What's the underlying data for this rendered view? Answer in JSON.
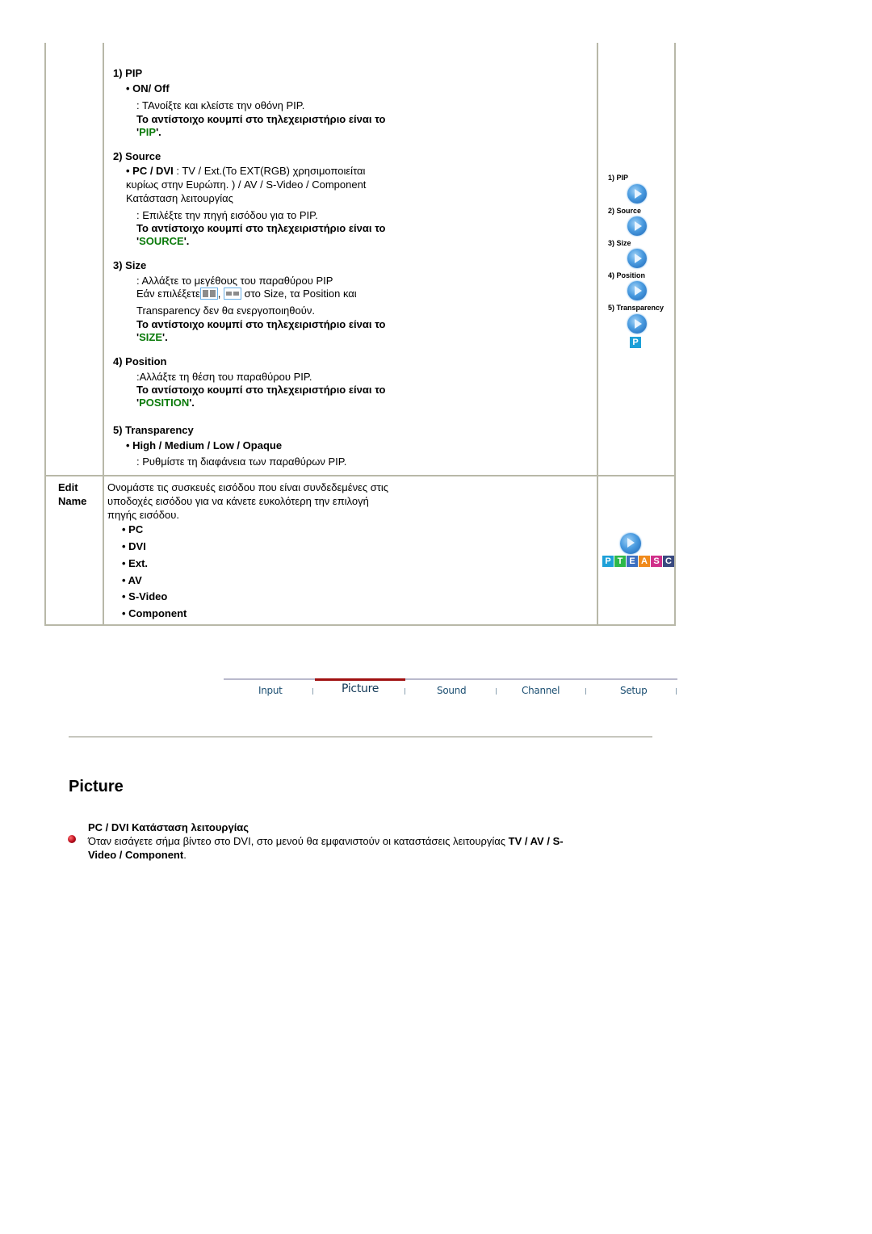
{
  "table": {
    "row1": {
      "label": "",
      "pip": {
        "heading": "1) PIP",
        "option": "• ON/ Off",
        "desc": ": ΤΑνοίξτε και κλείστε την οθόνη PIP.",
        "remote_prefix": "Το αντίστοιχο κουμπί στο τηλεχειριστήριο είναι το",
        "remote_key": "PIP",
        "remote_open": "'",
        "remote_close": "'."
      },
      "source": {
        "heading": "2) Source",
        "option_bold": "• PC / DVI",
        "option_rest": " : TV / Ext.(Το EXT(RGB) χρησιμοποιείται",
        "line2": "κυρίως στην Ευρώπη. ) / AV / S-Video / Component",
        "line3": "Κατάσταση λειτουργίας",
        "desc": ": Επιλέξτε την πηγή εισόδου για το PIP.",
        "remote_prefix": "Το αντίστοιχο κουμπί στο τηλεχειριστήριο είναι το",
        "remote_key": "SOURCE",
        "remote_open": "'",
        "remote_close": "'."
      },
      "size": {
        "heading": "3) Size",
        "desc": ": Αλλάξτε το μεγέθους του παραθύρου PIP",
        "line2_a": "Εάν επιλέξετε",
        "line2_b": ",",
        "line2_c": "στο Size, τα Position και",
        "line3": "Transparency δεν θα ενεργοποιηθούν.",
        "remote_prefix": "Το αντίστοιχο κουμπί στο τηλεχειριστήριο είναι το",
        "remote_key": "SIZE",
        "remote_open": "'",
        "remote_close": "'."
      },
      "position": {
        "heading": "4) Position",
        "desc": ":Αλλάξτε τη θέση του παραθύρου PIP.",
        "remote_prefix": "Το αντίστοιχο κουμπί στο τηλεχειριστήριο είναι το",
        "remote_key": "POSITION",
        "remote_open": "'",
        "remote_close": "'."
      },
      "transparency": {
        "heading": "5) Transparency",
        "option": "• High / Medium / Low / Opaque",
        "desc": ": Ρυθμίστε τη διαφάνεια των παραθύρων PIP."
      },
      "side_menu": [
        {
          "label": "1) PIP",
          "icon": "play-icon"
        },
        {
          "label": "2) Source",
          "icon": "play-icon"
        },
        {
          "label": "3) Size",
          "icon": "play-icon"
        },
        {
          "label": "4) Position",
          "icon": "play-icon"
        },
        {
          "label": "5) Transparency",
          "icon": "play-icon"
        }
      ],
      "side_badge": "P"
    },
    "row2": {
      "label_line1": "Edit",
      "label_line2": "Name",
      "desc_line1": "Ονομάστε τις συσκευές εισόδου που είναι συνδεδεμένες στις",
      "desc_line2": "υποδοχές εισόδου για να κάνετε ευκολότερη την επιλογή",
      "desc_line3": "πηγής εισόδου.",
      "items": [
        "• PC",
        "• DVI",
        "• Ext.",
        "• AV",
        "• S-Video",
        "• Component"
      ],
      "side_letters": [
        {
          "char": "P",
          "color": "#1da0d8"
        },
        {
          "char": "T",
          "color": "#2db84a"
        },
        {
          "char": "E",
          "color": "#3c6fc0"
        },
        {
          "char": "A",
          "color": "#f08a1c"
        },
        {
          "char": "S",
          "color": "#d0308a"
        },
        {
          "char": "C",
          "color": "#3a4a80"
        }
      ]
    }
  },
  "nav": {
    "tabs": [
      {
        "label": "Input",
        "active": false
      },
      {
        "label": "Picture",
        "active": true
      },
      {
        "label": "Sound",
        "active": false
      },
      {
        "label": "Channel",
        "active": false
      },
      {
        "label": "Setup",
        "active": false
      }
    ],
    "active_color": "#a01010"
  },
  "section": {
    "title": "Picture",
    "subheading": "PC / DVI Κατάσταση λειτουργίας",
    "body_line1": "Όταν εισάγετε σήμα βίντεο στο DVI, στο μενού θα εμφανιστούν οι καταστάσεις λειτουργίας ",
    "body_line1_bold": "TV / AV / S-",
    "body_line2_bold": "Video / Component",
    "body_line2_end": "."
  },
  "colors": {
    "remote_key": "#0a7a0a",
    "border": "#b8b8a8"
  }
}
